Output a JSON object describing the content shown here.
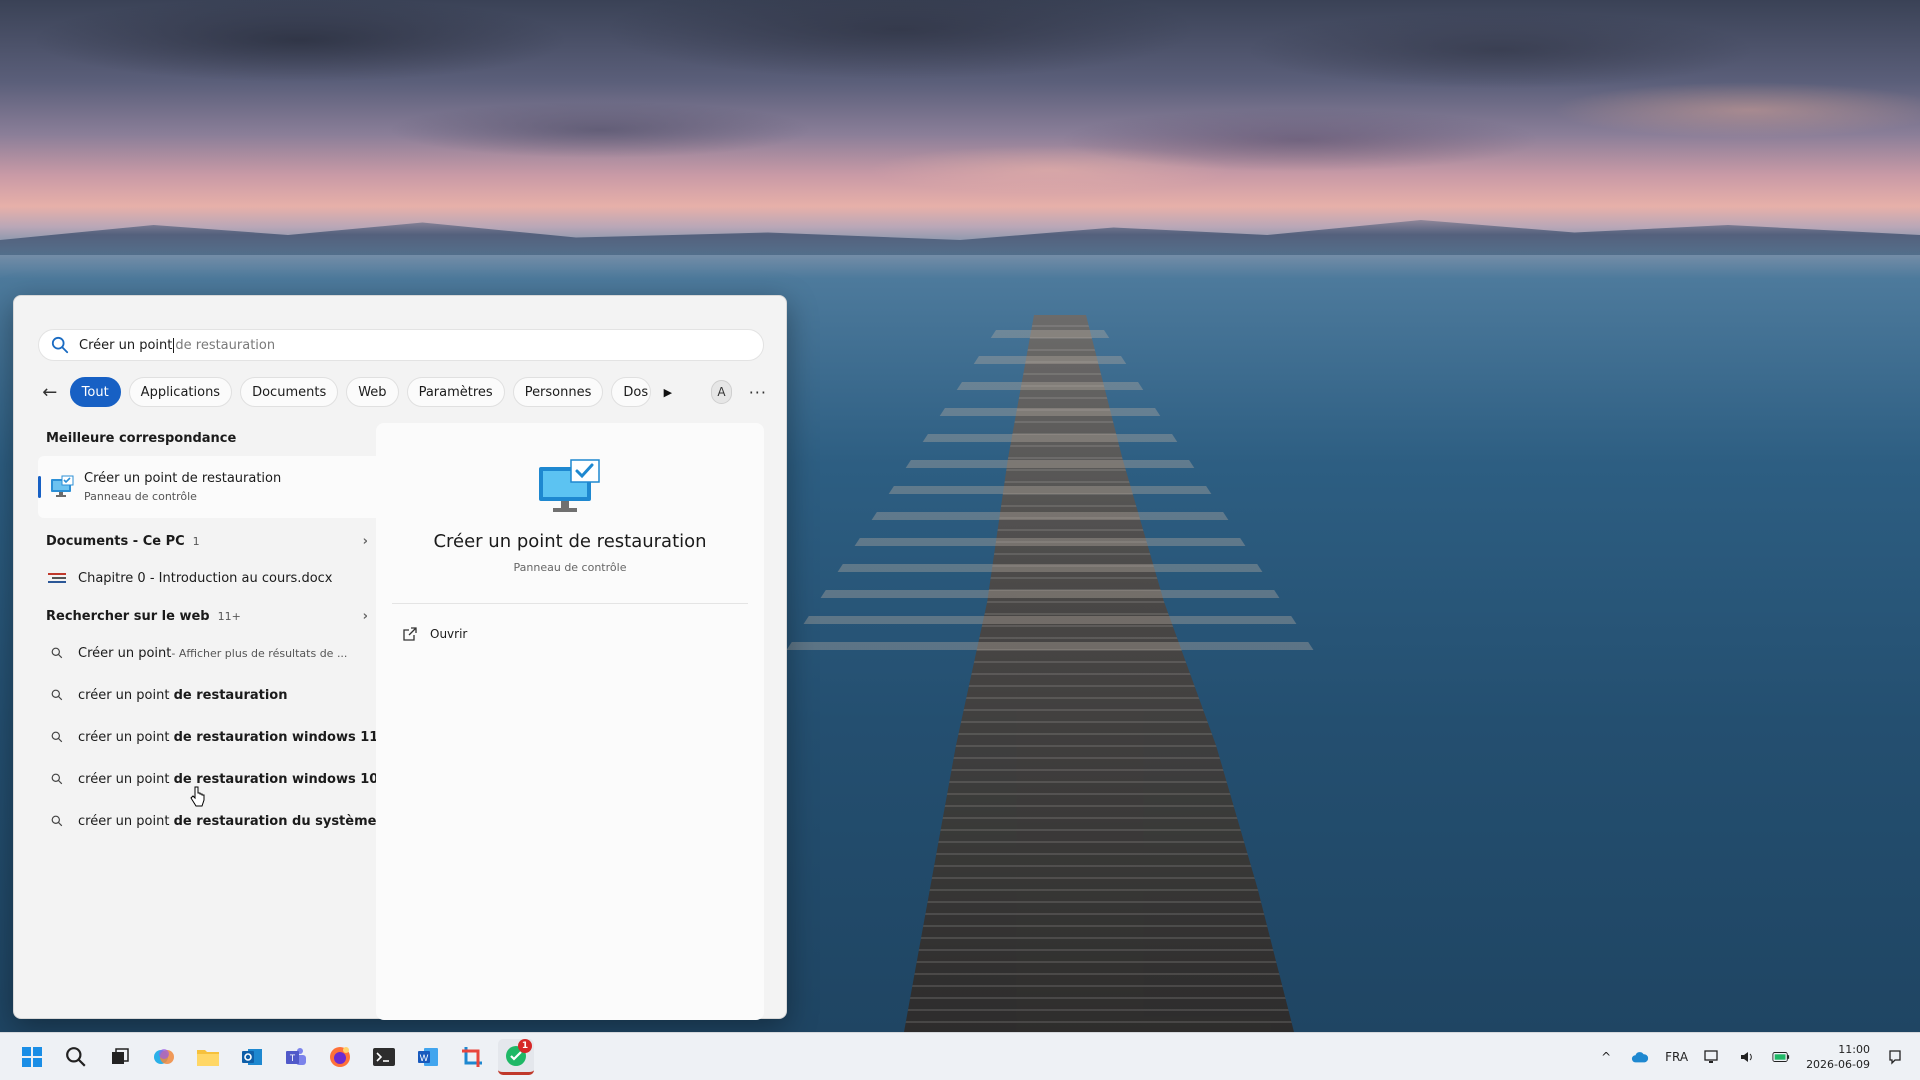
{
  "search": {
    "typed": "Créer un point",
    "suggestion": "de restauration"
  },
  "filters": {
    "back": "←",
    "chips": [
      "Tout",
      "Applications",
      "Documents",
      "Web",
      "Paramètres",
      "Personnes",
      "Dos"
    ],
    "avatar": "A",
    "more": "···"
  },
  "best_match": {
    "heading": "Meilleure correspondance",
    "title": "Créer un point de restauration",
    "subtitle": "Panneau de contrôle"
  },
  "documents": {
    "heading": "Documents - Ce PC",
    "count": "1",
    "item": "Chapitre 0 - Introduction au cours.docx"
  },
  "web": {
    "heading": "Rechercher sur le web",
    "count": "11+",
    "first": {
      "bold": "Créer un point",
      "rest": " - Afficher plus de résultats de ..."
    },
    "items": [
      {
        "plain": "créer un point ",
        "bold": "de restauration"
      },
      {
        "plain": "créer un point ",
        "bold": "de restauration windows 11"
      },
      {
        "plain": "créer un point ",
        "bold": "de restauration windows 10"
      },
      {
        "plain": "créer un point ",
        "bold": "de restauration du système"
      }
    ]
  },
  "preview": {
    "title": "Créer un point de restauration",
    "subtitle": "Panneau de contrôle",
    "action": "Ouvrir"
  },
  "taskbar": {
    "badge": "1",
    "language": "FRA",
    "time": "11:00",
    "date": "2026-06-09"
  },
  "colors": {
    "accent": "#1760c4"
  }
}
